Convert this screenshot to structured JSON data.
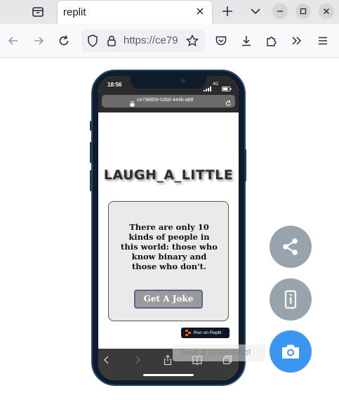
{
  "browser": {
    "tab_title": "replit",
    "url": "https://ce79"
  },
  "phone": {
    "status_time": "18:56",
    "network": "4G",
    "address": "ce798859-02b0-444b-a88"
  },
  "app": {
    "title": "LAUGH_A_LITTLE",
    "joke": "There are only 10 kinds of people in this world: those who know binary and those who don't.",
    "button_label": "Get A Joke",
    "badge_label": "Run on Replit"
  },
  "tooltip": {
    "text": "Take a screenshot"
  },
  "colors": {
    "fab_gray": "#97a3ad",
    "fab_blue": "#3a96f1",
    "phone_frame": "#0e1c2c"
  },
  "icons": [
    "tab-list-icon",
    "close-icon",
    "plus-icon",
    "chevron-down-icon",
    "minimize-icon",
    "maximize-icon",
    "back-arrow-icon",
    "forward-arrow-icon",
    "reload-icon",
    "shield-icon",
    "lock-icon",
    "star-icon",
    "pocket-icon",
    "download-icon",
    "extensions-icon",
    "overflow-icon",
    "menu-icon",
    "share-icon",
    "device-info-icon",
    "camera-icon"
  ]
}
